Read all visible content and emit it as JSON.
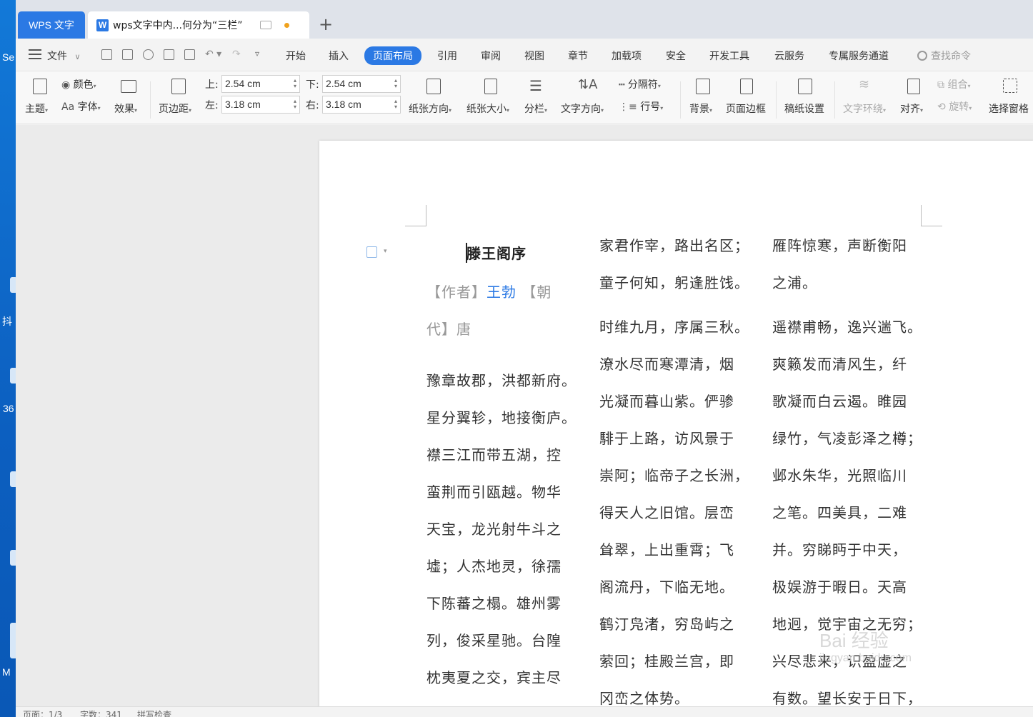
{
  "desktop": {
    "labels": [
      "Se",
      "抖",
      "36",
      "M"
    ]
  },
  "tabs": {
    "app_tab": "WPS 文字",
    "doc_tab": "wps文字中内...何分为“三栏”",
    "doc_icon": "W",
    "new_tab": "+"
  },
  "menu": {
    "file": "文件",
    "items": [
      "开始",
      "插入",
      "页面布局",
      "引用",
      "审阅",
      "视图",
      "章节",
      "加载项",
      "安全",
      "开发工具",
      "云服务",
      "专属服务通道"
    ],
    "active": "页面布局",
    "search_placeholder": "查找命令"
  },
  "ribbon": {
    "theme": "主题",
    "color": "颜色",
    "font": "字体",
    "font_prefix": "Aa",
    "effect": "效果",
    "margins": "页边距",
    "top_label": "上:",
    "top_value": "2.54 cm",
    "bottom_label": "下:",
    "bottom_value": "2.54 cm",
    "left_label": "左:",
    "left_value": "3.18 cm",
    "right_label": "右:",
    "right_value": "3.18 cm",
    "orientation": "纸张方向",
    "size": "纸张大小",
    "columns": "分栏",
    "text_direction": "文字方向",
    "separator": "分隔符",
    "line_number": "行号",
    "background": "背景",
    "page_border": "页面边框",
    "manuscript": "稿纸设置",
    "text_wrap": "文字环绕",
    "align": "对齐",
    "group": "组合",
    "rotate": "旋转",
    "selection_pane": "选择窗格"
  },
  "document": {
    "title": "滕王阁序",
    "author_line1_prefix": "【作者】",
    "author_name": "王勃",
    "author_line1_suffix": " 【朝",
    "author_line2": "代】唐",
    "col1": [
      "豫章故郡，洪都新府。",
      "星分翼轸，地接衡庐。",
      "襟三江而带五湖，控",
      "蛮荆而引瓯越。物华",
      "天宝，龙光射牛斗之",
      "墟；人杰地灵，徐孺",
      "下陈蕃之榻。雄州雾",
      "列，俊采星驰。台隍",
      "枕夷夏之交，宾主尽"
    ],
    "col2a": [
      "家君作宰，路出名区；",
      "童子何知，躬逢胜饯。"
    ],
    "col2b": [
      "时维九月，序属三秋。",
      "潦水尽而寒潭清，烟",
      "光凝而暮山紫。俨骖",
      "騑于上路，访风景于",
      "崇阿；临帝子之长洲，",
      "得天人之旧馆。层峦",
      "耸翠，上出重霄；飞",
      "阁流丹，下临无地。",
      "鹤汀凫渚，穷岛屿之",
      "萦回；桂殿兰宫，即",
      "冈峦之体势。"
    ],
    "col3a": [
      "雁阵惊寒，声断衡阳",
      "之浦。"
    ],
    "col3b": [
      "遥襟甫畅，逸兴遄飞。",
      "爽籁发而清风生，纤",
      "歌凝而白云遏。睢园",
      "绿竹，气凌彭泽之樽；",
      "邺水朱华，光照临川",
      "之笔。四美具，二难",
      "并。穷睇眄于中天，",
      "极娱游于暇日。天高",
      "地迥，觉宇宙之无穷；",
      "兴尽悲来，识盈虚之",
      "有数。望长安于日下，"
    ],
    "watermark": "Bai 经验",
    "watermark_sub": "jingyan.baidu.com"
  },
  "status": {
    "page": "页面：1/3",
    "words": "字数：341",
    "spell": "拼写检查"
  }
}
